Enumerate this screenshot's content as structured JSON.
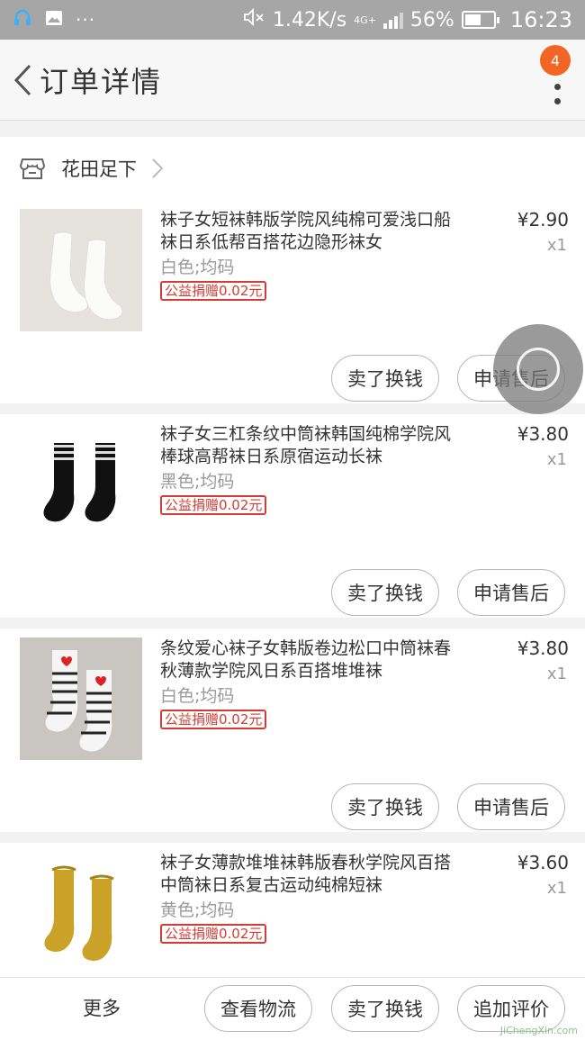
{
  "status_bar": {
    "net_speed": "1.42K/s",
    "network": "4G+",
    "battery": "56%",
    "battery_level": 0.56,
    "time": "16:23"
  },
  "header": {
    "title": "订单详情",
    "badge_count": "4"
  },
  "shop": {
    "name": "花田足下"
  },
  "items": [
    {
      "title": "袜子女短袜韩版学院风纯棉可爱浅口船袜日系低帮百搭花边隐形袜女",
      "spec": "白色;均码",
      "tag": "公益捐赠0.02元",
      "price": "¥2.90",
      "qty": "x1",
      "sell_label": "卖了换钱",
      "after_sale_label": "申请售后"
    },
    {
      "title": "袜子女三杠条纹中筒袜韩国纯棉学院风棒球高帮袜日系原宿运动长袜",
      "spec": "黑色;均码",
      "tag": "公益捐赠0.02元",
      "price": "¥3.80",
      "qty": "x1",
      "sell_label": "卖了换钱",
      "after_sale_label": "申请售后"
    },
    {
      "title": "条纹爱心袜子女韩版卷边松口中筒袜春秋薄款学院风日系百搭堆堆袜",
      "spec": "白色;均码",
      "tag": "公益捐赠0.02元",
      "price": "¥3.80",
      "qty": "x1",
      "sell_label": "卖了换钱",
      "after_sale_label": "申请售后"
    },
    {
      "title": "袜子女薄款堆堆袜韩版春秋学院风百搭中筒袜日系复古运动纯棉短袜",
      "spec": "黄色;均码",
      "tag": "公益捐赠0.02元",
      "price": "¥3.60",
      "qty": "x1"
    }
  ],
  "bottom_bar": {
    "more": "更多",
    "logistics": "查看物流",
    "sell": "卖了换钱",
    "review": "追加评价"
  },
  "watermark": "JiChengXin.com"
}
